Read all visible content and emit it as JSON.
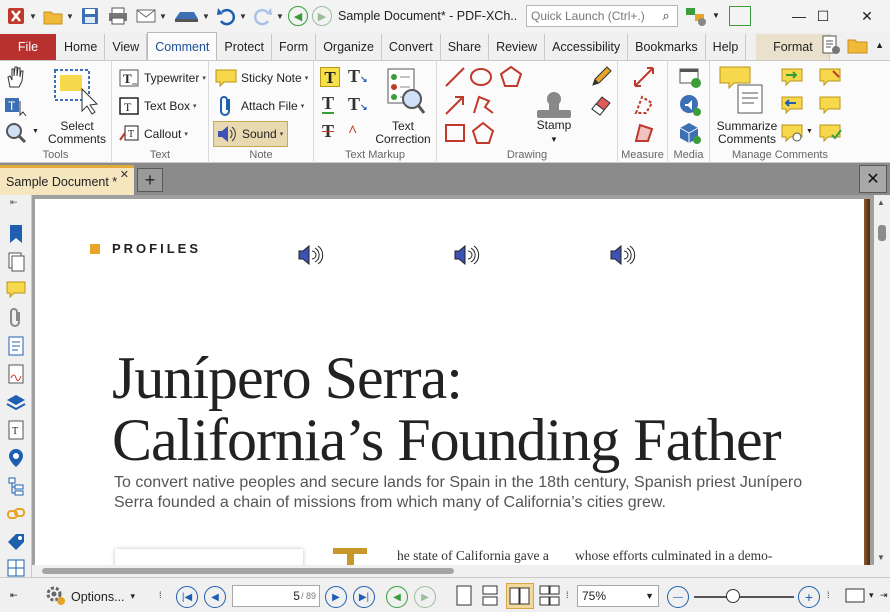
{
  "titlebar": {
    "doc_title": "Sample Document* - PDF-XCh..",
    "quick_launch_placeholder": "Quick Launch (Ctrl+.)"
  },
  "tabs": [
    "File",
    "Home",
    "View",
    "Comment",
    "Protect",
    "Form",
    "Organize",
    "Convert",
    "Share",
    "Review",
    "Accessibility",
    "Bookmarks",
    "Help",
    "Format"
  ],
  "ribbon": {
    "tools": {
      "select_comments": "Select\nComments",
      "label": "Tools"
    },
    "text": {
      "typewriter": "Typewriter",
      "text_box": "Text Box",
      "callout": "Callout",
      "label": "Text"
    },
    "note": {
      "sticky_note": "Sticky Note",
      "attach_file": "Attach File",
      "sound": "Sound",
      "label": "Note"
    },
    "text_markup": {
      "text_correction": "Text\nCorrection",
      "label": "Text Markup"
    },
    "drawing": {
      "stamp": "Stamp",
      "label": "Drawing"
    },
    "measure": {
      "label": "Measure"
    },
    "media": {
      "label": "Media"
    },
    "manage": {
      "summarize": "Summarize\nComments",
      "label": "Manage Comments"
    }
  },
  "doc_tab": {
    "title": "Sample Document *"
  },
  "page": {
    "section": "PROFILES",
    "headline_line1": "Junípero Serra:",
    "headline_line2": "California’s Founding Father",
    "subhead": "To convert native peoples and secure lands for Spain in the 18th century, Spanish priest Junípero Serra founded a chain of missions from which many of California’s cities grew.",
    "body_left": "he state of California gave a",
    "body_right": "whose efforts culminated in a demo-"
  },
  "statusbar": {
    "options": "Options...",
    "page_current": "5",
    "page_total": "/ 89",
    "zoom": "75%"
  },
  "colors": {
    "file_tab": "#b8312f",
    "accent_gold": "#e8a32a",
    "nav_blue": "#1f5fb0",
    "nav_green": "#3a9d3a"
  },
  "icons": [
    "app-icon",
    "folder-icon",
    "save-icon",
    "print-icon",
    "email-icon",
    "scan-icon",
    "undo-icon",
    "redo-icon",
    "back-icon",
    "forward-icon",
    "search-icon",
    "hand-icon",
    "select-text-icon",
    "zoom-icon",
    "typewriter-icon",
    "textbox-icon",
    "callout-icon",
    "sticky-note-icon",
    "attach-file-icon",
    "sound-icon",
    "highlight-icon",
    "stamp-icon",
    "pencil-icon",
    "eraser-icon",
    "line-icon",
    "oval-icon",
    "polygon-icon",
    "rectangle-icon",
    "video-icon",
    "summarize-icon",
    "close-icon",
    "new-tab-icon"
  ]
}
